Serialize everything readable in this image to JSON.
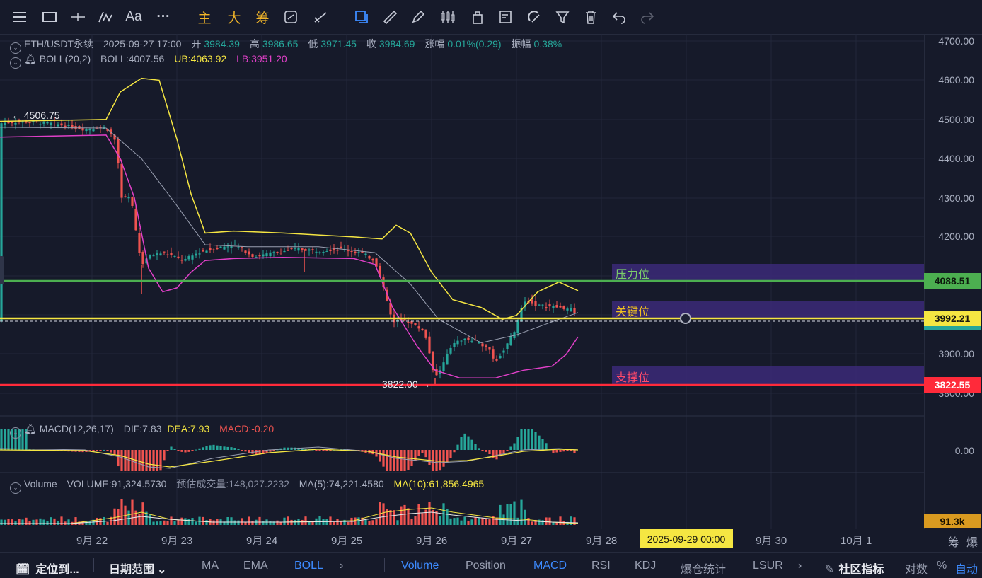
{
  "toolbar": {
    "items": [
      {
        "name": "menu-icon",
        "glyph": "☰"
      },
      {
        "name": "window-icon",
        "glyph": "▭"
      },
      {
        "name": "crosshair-icon",
        "glyph": "┼"
      },
      {
        "name": "indicator-icon",
        "glyph": "⁄∿"
      },
      {
        "name": "font-icon",
        "glyph": "Aa"
      },
      {
        "name": "more-icon",
        "glyph": "···"
      },
      {
        "name": "main-label",
        "glyph": "主"
      },
      {
        "name": "big-label",
        "glyph": "大"
      },
      {
        "name": "chip-label",
        "glyph": "筹"
      },
      {
        "name": "sync-icon",
        "glyph": "⟲"
      },
      {
        "name": "draw-line-icon",
        "glyph": "⟋"
      },
      {
        "name": "copy-icon",
        "glyph": "❐"
      },
      {
        "name": "ruler-icon",
        "glyph": "📏"
      },
      {
        "name": "pen-icon",
        "glyph": "✎"
      },
      {
        "name": "candle-icon",
        "glyph": "⫼"
      },
      {
        "name": "shape-icon",
        "glyph": "⬚"
      },
      {
        "name": "note-icon",
        "glyph": "✍"
      },
      {
        "name": "magnet-icon",
        "glyph": "∩"
      },
      {
        "name": "filter-icon",
        "glyph": "⏷"
      },
      {
        "name": "trash-icon",
        "glyph": "🗑"
      },
      {
        "name": "undo-icon",
        "glyph": "↶"
      },
      {
        "name": "redo-icon",
        "glyph": "↷"
      }
    ]
  },
  "legend": {
    "symbol": "ETH/USDT永续",
    "datetime": "2025-09-27 17:00",
    "open_label": "开",
    "open": "3984.39",
    "high_label": "高",
    "high": "3986.65",
    "low_label": "低",
    "low": "3971.45",
    "close_label": "收",
    "close": "3984.69",
    "change_label": "涨幅",
    "change": "0.01%(0.29)",
    "amp_label": "振幅",
    "amp": "0.38%",
    "boll_name": "BOLL(20,2)",
    "boll_mid": "BOLL:4007.56",
    "boll_ub": "UB:4063.92",
    "boll_lb": "LB:3951.20"
  },
  "macd_legend": {
    "name": "MACD(12,26,17)",
    "dif": "DIF:7.83",
    "dea": "DEA:7.93",
    "macd": "MACD:-0.20"
  },
  "volume_legend": {
    "name": "Volume",
    "volume": "VOLUME:91,324.5730",
    "est": "预估成交量:148,027.2232",
    "ma5": "MA(5):74,221.4580",
    "ma10": "MA(10):61,856.4965"
  },
  "price_axis": {
    "labels": [
      "4700.00",
      "4600.00",
      "4500.00",
      "4400.00",
      "4300.00",
      "4200.00",
      "3900.00",
      "3800.00"
    ],
    "macd_zero": "0.00"
  },
  "tags": {
    "resistance_price": "4088.51",
    "key_price": "3992.21",
    "support_price": "3822.55",
    "volume": "91.3k"
  },
  "zones": {
    "resistance": "压力位",
    "key": "关键位",
    "support": "支撑位"
  },
  "annotations": {
    "high_marker": "← 4506.75",
    "low_marker": "3822.00 →"
  },
  "time_axis": {
    "labels": [
      "9月 22",
      "9月 23",
      "9月 24",
      "9月 25",
      "9月 26",
      "9月 27",
      "9月 28",
      "9月 30",
      "10月 1"
    ],
    "cursor": "2025-09-29 00:00",
    "chip": "筹",
    "burst": "爆"
  },
  "bottom_bar": {
    "locate": "定位到...",
    "date_range": "日期范围",
    "ma": "MA",
    "ema": "EMA",
    "boll": "BOLL",
    "volume": "Volume",
    "position": "Position",
    "macd": "MACD",
    "rsi": "RSI",
    "kdj": "KDJ",
    "liq": "爆仓统计",
    "lsur": "LSUR",
    "community": "社区指标",
    "log": "对数",
    "pct": "%",
    "auto": "自动"
  },
  "colors": {
    "up": "#26a69a",
    "down": "#ef5350",
    "boll_upper": "#f5e642",
    "boll_lower": "#e040c8",
    "resistance": "#4caf50",
    "key": "#f5e642",
    "support": "#ff2a3a",
    "zone": "#3b2a78",
    "accent": "#3d8bff"
  },
  "chart_data": {
    "type": "candlestick",
    "symbol": "ETH/USDT永续",
    "x_range": [
      "2025-09-22",
      "2025-09-27"
    ],
    "ylim": [
      3780,
      4700
    ],
    "price_path": [
      [
        0,
        4490
      ],
      [
        30,
        4495
      ],
      [
        80,
        4488
      ],
      [
        120,
        4475
      ],
      [
        150,
        4480
      ],
      [
        165,
        4440
      ],
      [
        170,
        4300
      ],
      [
        185,
        4300
      ],
      [
        195,
        4180
      ],
      [
        200,
        4130
      ],
      [
        210,
        4150
      ],
      [
        230,
        4160
      ],
      [
        260,
        4140
      ],
      [
        280,
        4160
      ],
      [
        300,
        4170
      ],
      [
        330,
        4180
      ],
      [
        360,
        4150
      ],
      [
        390,
        4160
      ],
      [
        420,
        4170
      ],
      [
        450,
        4165
      ],
      [
        480,
        4170
      ],
      [
        510,
        4160
      ],
      [
        530,
        4140
      ],
      [
        545,
        4050
      ],
      [
        555,
        3980
      ],
      [
        570,
        3990
      ],
      [
        600,
        3960
      ],
      [
        615,
        3840
      ],
      [
        625,
        3870
      ],
      [
        640,
        3930
      ],
      [
        660,
        3940
      ],
      [
        690,
        3920
      ],
      [
        700,
        3880
      ],
      [
        715,
        3920
      ],
      [
        730,
        3970
      ],
      [
        740,
        4040
      ],
      [
        760,
        4025
      ],
      [
        790,
        4020
      ],
      [
        810,
        4015
      ],
      [
        817,
        3985
      ]
    ],
    "boll_upper_path": [
      [
        0,
        4495
      ],
      [
        150,
        4500
      ],
      [
        170,
        4570
      ],
      [
        200,
        4605
      ],
      [
        225,
        4600
      ],
      [
        250,
        4450
      ],
      [
        270,
        4310
      ],
      [
        290,
        4210
      ],
      [
        330,
        4215
      ],
      [
        400,
        4210
      ],
      [
        500,
        4200
      ],
      [
        540,
        4195
      ],
      [
        560,
        4230
      ],
      [
        580,
        4210
      ],
      [
        610,
        4110
      ],
      [
        640,
        4040
      ],
      [
        680,
        4020
      ],
      [
        710,
        3990
      ],
      [
        730,
        4000
      ],
      [
        760,
        4060
      ],
      [
        790,
        4085
      ],
      [
        817,
        4063
      ]
    ],
    "boll_lower_path": [
      [
        0,
        4455
      ],
      [
        150,
        4460
      ],
      [
        170,
        4400
      ],
      [
        190,
        4300
      ],
      [
        210,
        4120
      ],
      [
        230,
        4060
      ],
      [
        250,
        4070
      ],
      [
        270,
        4110
      ],
      [
        290,
        4140
      ],
      [
        330,
        4145
      ],
      [
        400,
        4148
      ],
      [
        500,
        4145
      ],
      [
        530,
        4130
      ],
      [
        555,
        4020
      ],
      [
        590,
        3920
      ],
      [
        615,
        3860
      ],
      [
        650,
        3840
      ],
      [
        700,
        3840
      ],
      [
        740,
        3860
      ],
      [
        780,
        3870
      ],
      [
        800,
        3900
      ],
      [
        817,
        3945
      ]
    ],
    "boll_mid_path": [
      [
        0,
        4480
      ],
      [
        150,
        4478
      ],
      [
        200,
        4400
      ],
      [
        250,
        4280
      ],
      [
        290,
        4180
      ],
      [
        350,
        4175
      ],
      [
        450,
        4175
      ],
      [
        530,
        4160
      ],
      [
        580,
        4080
      ],
      [
        620,
        3990
      ],
      [
        680,
        3930
      ],
      [
        730,
        3950
      ],
      [
        790,
        3990
      ],
      [
        817,
        4007
      ]
    ],
    "levels": {
      "resistance": 4088.51,
      "key": 3992.21,
      "support": 3822.55
    },
    "last_price": 3984.69
  }
}
